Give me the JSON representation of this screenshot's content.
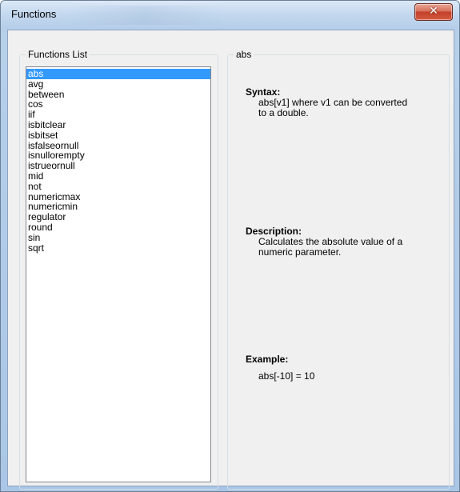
{
  "window": {
    "title": "Functions",
    "close_glyph": "✕"
  },
  "functions_list": {
    "legend": "Functions List",
    "items": [
      "abs",
      "avg",
      "between",
      "cos",
      "iif",
      "isbitclear",
      "isbitset",
      "isfalseornull",
      "isnullorempty",
      "istrueornull",
      "mid",
      "not",
      "numericmax",
      "numericmin",
      "regulator",
      "round",
      "sin",
      "sqrt"
    ],
    "selected_index": 0
  },
  "details": {
    "legend": "abs",
    "syntax_label": "Syntax:",
    "syntax_line1": "abs[v1] where v1 can be converted",
    "syntax_line2": "to a double.",
    "description_label": "Description:",
    "description_line1": "Calculates the absolute value of a",
    "description_line2": "numeric parameter.",
    "example_label": "Example:",
    "example_text": "abs[-10] = 10"
  },
  "colors": {
    "selection": "#3399ff",
    "close_button": "#c2402a"
  },
  "icons": {
    "close": "close-icon"
  }
}
